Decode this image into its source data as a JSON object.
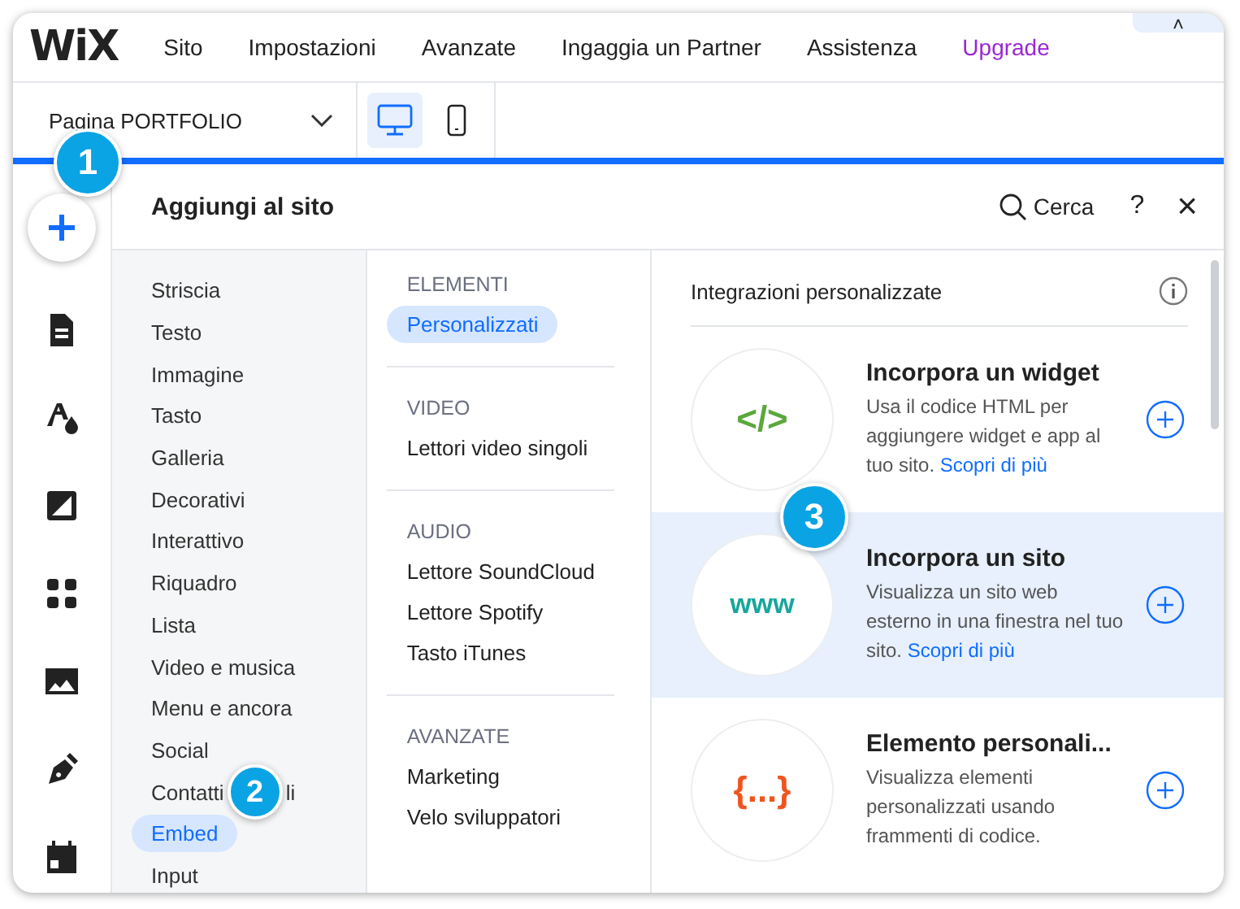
{
  "topbar": {
    "logo": "WiX",
    "menu": [
      {
        "label": "Sito",
        "kind": "plain"
      },
      {
        "label": "Impostazioni",
        "kind": "plain"
      },
      {
        "label": "Avanzate",
        "kind": "plain"
      },
      {
        "label": "Ingaggia un Partner",
        "kind": "plain"
      },
      {
        "label": "Assistenza",
        "kind": "plain"
      },
      {
        "label": "Upgrade",
        "kind": "upgrade"
      }
    ],
    "collapse": "˄"
  },
  "toolbar": {
    "page_label": "Pagina PORTFOLIO",
    "views": [
      {
        "kind": "desktop",
        "selected": true
      },
      {
        "kind": "mobile",
        "selected": false
      }
    ]
  },
  "panel": {
    "title": "Aggiungi al sito",
    "search": "Cerca",
    "help": "?",
    "close": "×",
    "categories": [
      {
        "label": "Striscia",
        "selected": false
      },
      {
        "label": "Testo",
        "selected": false
      },
      {
        "label": "Immagine",
        "selected": false
      },
      {
        "label": "Tasto",
        "selected": false
      },
      {
        "label": "Galleria",
        "selected": false
      },
      {
        "label": "Decorativi",
        "selected": false
      },
      {
        "label": "Interattivo",
        "selected": false
      },
      {
        "label": "Riquadro",
        "selected": false
      },
      {
        "label": "Lista",
        "selected": false
      },
      {
        "label": "Video e musica",
        "selected": false
      },
      {
        "label": "Menu e ancora",
        "selected": false
      },
      {
        "label": "Social",
        "selected": false
      },
      {
        "label": "Contatti",
        "badge": "2",
        "tail": "li",
        "selected": false
      },
      {
        "label": "Embed",
        "selected": true
      },
      {
        "label": "Input",
        "selected": false
      }
    ],
    "sections": [
      {
        "heading": "ELEMENTI",
        "items": [
          {
            "label": "Personalizzati",
            "selected": true
          }
        ]
      },
      {
        "heading": "VIDEO",
        "items": [
          {
            "label": "Lettori video singoli",
            "selected": false
          }
        ]
      },
      {
        "heading": "AUDIO",
        "items": [
          {
            "label": "Lettore SoundCloud",
            "selected": false
          },
          {
            "label": "Lettore Spotify",
            "selected": false
          },
          {
            "label": "Tasto iTunes",
            "selected": false
          }
        ]
      },
      {
        "heading": "AVANZATE",
        "items": [
          {
            "label": "Marketing",
            "selected": false
          },
          {
            "label": "Velo sviluppatori",
            "selected": false
          }
        ]
      }
    ],
    "content_heading": "Integrazioni personalizzate",
    "cards": [
      {
        "kind": "code",
        "icon_text": "</>",
        "title": "Incorpora un widget",
        "description": "Usa il codice HTML per aggiungere widget e app al tuo sito.",
        "link": "Scopri di più",
        "selected": false
      },
      {
        "kind": "web",
        "icon_text": "www",
        "title": "Incorpora un sito",
        "description": "Visualizza un sito web esterno in una finestra nel tuo sito.",
        "link": "Scopri di più",
        "selected": true
      },
      {
        "kind": "custom",
        "icon_text": "{...}",
        "title": "Elemento personali...",
        "description": "Visualizza elementi personalizzati usando frammenti di codice.",
        "selected": false
      }
    ]
  },
  "badges": [
    "1",
    "3"
  ]
}
